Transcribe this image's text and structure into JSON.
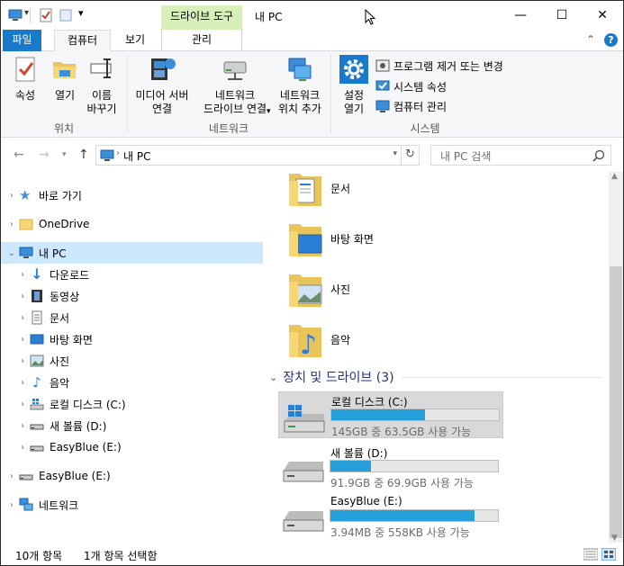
{
  "title_bar": {
    "context_tab_header": "드라이브 도구",
    "window_title": "내 PC",
    "minimize": "—",
    "maximize": "☐",
    "close": "✕"
  },
  "tabs": {
    "file": "파일",
    "computer": "컴퓨터",
    "view": "보기",
    "manage": "관리"
  },
  "ribbon": {
    "location": {
      "label": "위치",
      "properties": "속성",
      "open": "열기",
      "rename_line1": "이름",
      "rename_line2": "바꾸기"
    },
    "network": {
      "label": "네트워크",
      "media_line1": "미디어 서버",
      "media_line2": "연결",
      "map_line1": "네트워크",
      "map_line2": "드라이브 연결",
      "add_line1": "네트워크",
      "add_line2": "위치 추가"
    },
    "system": {
      "label": "시스템",
      "settings_line1": "설정",
      "settings_line2": "열기",
      "uninstall": "프로그램 제거 또는 변경",
      "sys_props": "시스템 속성",
      "manage": "컴퓨터 관리"
    }
  },
  "address": {
    "path": "내 PC",
    "search_placeholder": "내 PC 검색"
  },
  "nav": {
    "quick_access": "바로 가기",
    "onedrive": "OneDrive",
    "this_pc": "내 PC",
    "downloads": "다운로드",
    "videos": "동영상",
    "documents": "문서",
    "desktop": "바탕 화면",
    "pictures": "사진",
    "music": "음악",
    "local_disk": "로컬 디스크 (C:)",
    "new_volume": "새 볼륨 (D:)",
    "easyblue_sub": "EasyBlue (E:)",
    "easyblue": "EasyBlue (E:)",
    "network": "네트워크"
  },
  "folders": [
    {
      "name": "문서"
    },
    {
      "name": "바탕 화면"
    },
    {
      "name": "사진"
    },
    {
      "name": "음악"
    }
  ],
  "devices_section": "장치 및 드라이브 (3)",
  "drives": [
    {
      "name": "로컬 디스크 (C:)",
      "usage": "145GB 중 63.5GB 사용 가능",
      "fill": 0.56
    },
    {
      "name": "새 볼륨 (D:)",
      "usage": "91.9GB 중 69.9GB 사용 가능",
      "fill": 0.24
    },
    {
      "name": "EasyBlue (E:)",
      "usage": "3.94MB 중 558KB 사용 가능",
      "fill": 0.86
    }
  ],
  "status": {
    "count": "10개 항목",
    "selected": "1개 항목 선택함"
  },
  "colors": {
    "accent": "#1979ca",
    "drive_bar": "#26a0da",
    "selection": "#cce8ff",
    "context_tab": "#d7efb9"
  }
}
